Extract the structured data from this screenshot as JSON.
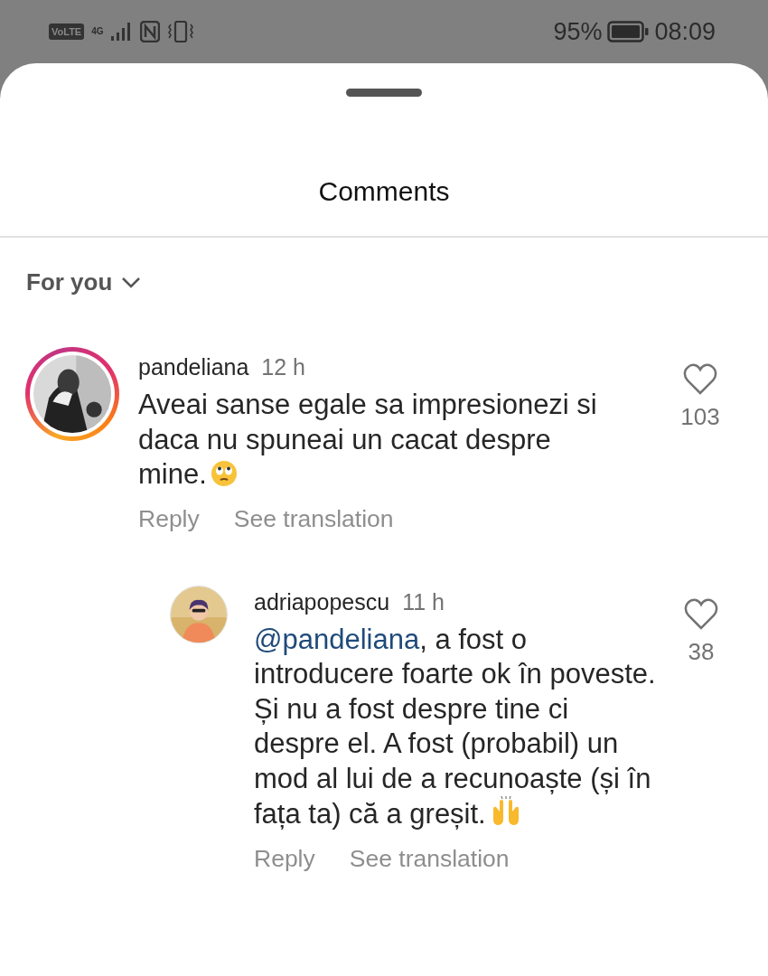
{
  "status_bar": {
    "volte": "VoLTE",
    "network": "4G",
    "battery": "95%",
    "time": "08:09"
  },
  "sheet": {
    "title": "Comments",
    "filter": "For you"
  },
  "comments": [
    {
      "username": "pandeliana",
      "time": "12 h",
      "story_ring": true,
      "text": "Aveai sanse egale sa impresionezi si daca nu spuneai un cacat despre mine.",
      "emoji": {
        "kind": "eye-roll"
      },
      "liked": false,
      "likes": "103",
      "actions": [
        "Reply",
        "See translation"
      ],
      "children": [
        {
          "username": "adriapopescu",
          "time": "11 h",
          "story_ring": false,
          "mention": "@pandeliana",
          "text": ", a fost o introducere foarte ok în poveste. Și nu a fost despre tine ci despre el. A fost (probabil) un mod al lui de a recunoaște (și în fața ta) că a greșit.",
          "emoji": {
            "kind": "raised-hands"
          },
          "liked": false,
          "likes": "38",
          "actions": [
            "Reply",
            "See translation"
          ]
        }
      ]
    }
  ]
}
